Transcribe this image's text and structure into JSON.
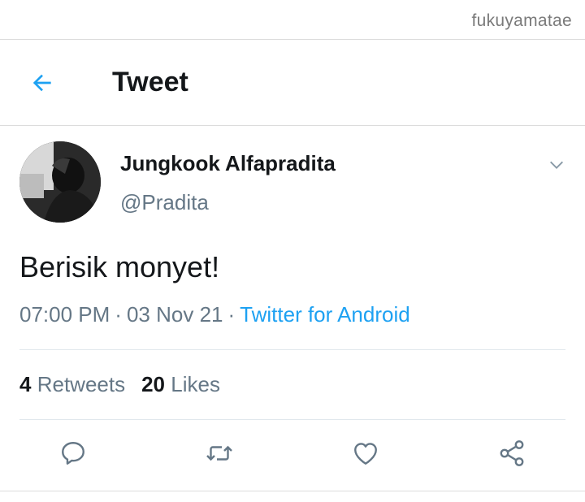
{
  "watermark": "fukuyamatae",
  "header": {
    "title": "Tweet",
    "back_icon": "arrow-left-icon"
  },
  "tweet": {
    "display_name": "Jungkook Alfapradita",
    "handle": "@Pradita",
    "text": "Berisik monyet!",
    "time": "07:00 PM",
    "separator": "·",
    "date": "03 Nov 21",
    "source": "Twitter for Android",
    "retweets_count": "4",
    "retweets_label": "Retweets",
    "likes_count": "20",
    "likes_label": "Likes"
  },
  "actions": [
    {
      "icon": "reply-icon"
    },
    {
      "icon": "retweet-icon"
    },
    {
      "icon": "like-icon"
    },
    {
      "icon": "share-icon"
    }
  ],
  "colors": {
    "accent": "#1da1f2",
    "secondary_text": "#657786",
    "primary_text": "#14171a",
    "divider": "#dcdcdc"
  }
}
